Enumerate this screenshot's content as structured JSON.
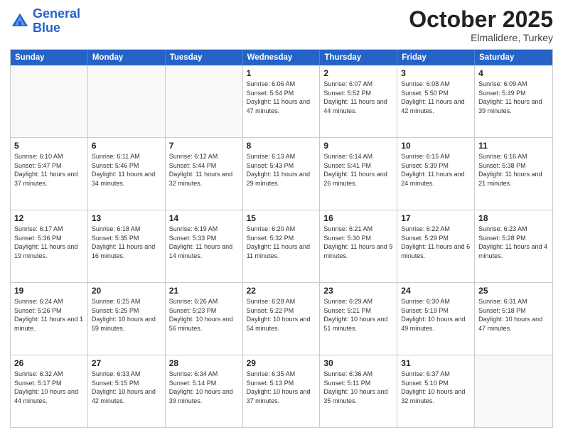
{
  "logo": {
    "line1": "General",
    "line2": "Blue"
  },
  "title": "October 2025",
  "subtitle": "Elmalidere, Turkey",
  "days": [
    "Sunday",
    "Monday",
    "Tuesday",
    "Wednesday",
    "Thursday",
    "Friday",
    "Saturday"
  ],
  "weeks": [
    [
      {
        "day": "",
        "text": ""
      },
      {
        "day": "",
        "text": ""
      },
      {
        "day": "",
        "text": ""
      },
      {
        "day": "1",
        "text": "Sunrise: 6:06 AM\nSunset: 5:54 PM\nDaylight: 11 hours and 47 minutes."
      },
      {
        "day": "2",
        "text": "Sunrise: 6:07 AM\nSunset: 5:52 PM\nDaylight: 11 hours and 44 minutes."
      },
      {
        "day": "3",
        "text": "Sunrise: 6:08 AM\nSunset: 5:50 PM\nDaylight: 11 hours and 42 minutes."
      },
      {
        "day": "4",
        "text": "Sunrise: 6:09 AM\nSunset: 5:49 PM\nDaylight: 11 hours and 39 minutes."
      }
    ],
    [
      {
        "day": "5",
        "text": "Sunrise: 6:10 AM\nSunset: 5:47 PM\nDaylight: 11 hours and 37 minutes."
      },
      {
        "day": "6",
        "text": "Sunrise: 6:11 AM\nSunset: 5:46 PM\nDaylight: 11 hours and 34 minutes."
      },
      {
        "day": "7",
        "text": "Sunrise: 6:12 AM\nSunset: 5:44 PM\nDaylight: 11 hours and 32 minutes."
      },
      {
        "day": "8",
        "text": "Sunrise: 6:13 AM\nSunset: 5:43 PM\nDaylight: 11 hours and 29 minutes."
      },
      {
        "day": "9",
        "text": "Sunrise: 6:14 AM\nSunset: 5:41 PM\nDaylight: 11 hours and 26 minutes."
      },
      {
        "day": "10",
        "text": "Sunrise: 6:15 AM\nSunset: 5:39 PM\nDaylight: 11 hours and 24 minutes."
      },
      {
        "day": "11",
        "text": "Sunrise: 6:16 AM\nSunset: 5:38 PM\nDaylight: 11 hours and 21 minutes."
      }
    ],
    [
      {
        "day": "12",
        "text": "Sunrise: 6:17 AM\nSunset: 5:36 PM\nDaylight: 11 hours and 19 minutes."
      },
      {
        "day": "13",
        "text": "Sunrise: 6:18 AM\nSunset: 5:35 PM\nDaylight: 11 hours and 16 minutes."
      },
      {
        "day": "14",
        "text": "Sunrise: 6:19 AM\nSunset: 5:33 PM\nDaylight: 11 hours and 14 minutes."
      },
      {
        "day": "15",
        "text": "Sunrise: 6:20 AM\nSunset: 5:32 PM\nDaylight: 11 hours and 11 minutes."
      },
      {
        "day": "16",
        "text": "Sunrise: 6:21 AM\nSunset: 5:30 PM\nDaylight: 11 hours and 9 minutes."
      },
      {
        "day": "17",
        "text": "Sunrise: 6:22 AM\nSunset: 5:29 PM\nDaylight: 11 hours and 6 minutes."
      },
      {
        "day": "18",
        "text": "Sunrise: 6:23 AM\nSunset: 5:28 PM\nDaylight: 11 hours and 4 minutes."
      }
    ],
    [
      {
        "day": "19",
        "text": "Sunrise: 6:24 AM\nSunset: 5:26 PM\nDaylight: 11 hours and 1 minute."
      },
      {
        "day": "20",
        "text": "Sunrise: 6:25 AM\nSunset: 5:25 PM\nDaylight: 10 hours and 59 minutes."
      },
      {
        "day": "21",
        "text": "Sunrise: 6:26 AM\nSunset: 5:23 PM\nDaylight: 10 hours and 56 minutes."
      },
      {
        "day": "22",
        "text": "Sunrise: 6:28 AM\nSunset: 5:22 PM\nDaylight: 10 hours and 54 minutes."
      },
      {
        "day": "23",
        "text": "Sunrise: 6:29 AM\nSunset: 5:21 PM\nDaylight: 10 hours and 51 minutes."
      },
      {
        "day": "24",
        "text": "Sunrise: 6:30 AM\nSunset: 5:19 PM\nDaylight: 10 hours and 49 minutes."
      },
      {
        "day": "25",
        "text": "Sunrise: 6:31 AM\nSunset: 5:18 PM\nDaylight: 10 hours and 47 minutes."
      }
    ],
    [
      {
        "day": "26",
        "text": "Sunrise: 6:32 AM\nSunset: 5:17 PM\nDaylight: 10 hours and 44 minutes."
      },
      {
        "day": "27",
        "text": "Sunrise: 6:33 AM\nSunset: 5:15 PM\nDaylight: 10 hours and 42 minutes."
      },
      {
        "day": "28",
        "text": "Sunrise: 6:34 AM\nSunset: 5:14 PM\nDaylight: 10 hours and 39 minutes."
      },
      {
        "day": "29",
        "text": "Sunrise: 6:35 AM\nSunset: 5:13 PM\nDaylight: 10 hours and 37 minutes."
      },
      {
        "day": "30",
        "text": "Sunrise: 6:36 AM\nSunset: 5:11 PM\nDaylight: 10 hours and 35 minutes."
      },
      {
        "day": "31",
        "text": "Sunrise: 6:37 AM\nSunset: 5:10 PM\nDaylight: 10 hours and 32 minutes."
      },
      {
        "day": "",
        "text": ""
      }
    ]
  ]
}
